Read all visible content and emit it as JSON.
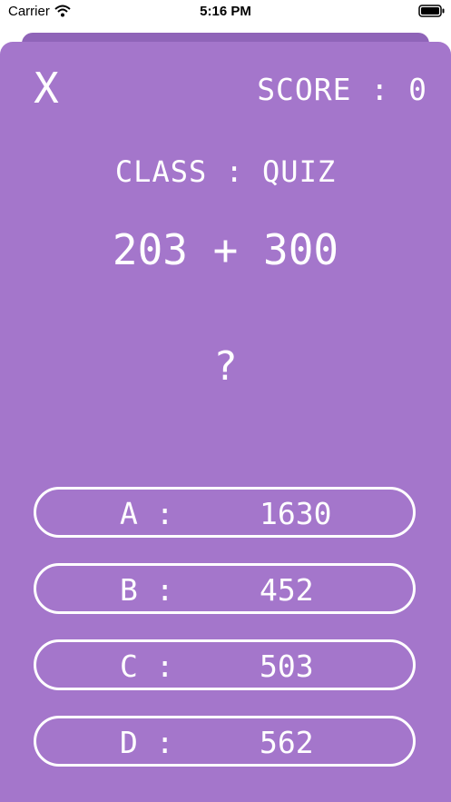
{
  "status": {
    "carrier": "Carrier",
    "time": "5:16 PM"
  },
  "header": {
    "close_label": "X",
    "score_label": "SCORE : 0"
  },
  "quiz": {
    "class_label": "CLASS : QUIZ",
    "problem": "203 + 300",
    "answer_placeholder": "?",
    "options": [
      {
        "letter": "A :",
        "value": "1630"
      },
      {
        "letter": "B :",
        "value": "452"
      },
      {
        "letter": "C :",
        "value": "503"
      },
      {
        "letter": "D :",
        "value": "562"
      }
    ]
  },
  "colors": {
    "sheet": "#a476cb",
    "card_back": "#8f64b8",
    "text": "#ffffff"
  }
}
